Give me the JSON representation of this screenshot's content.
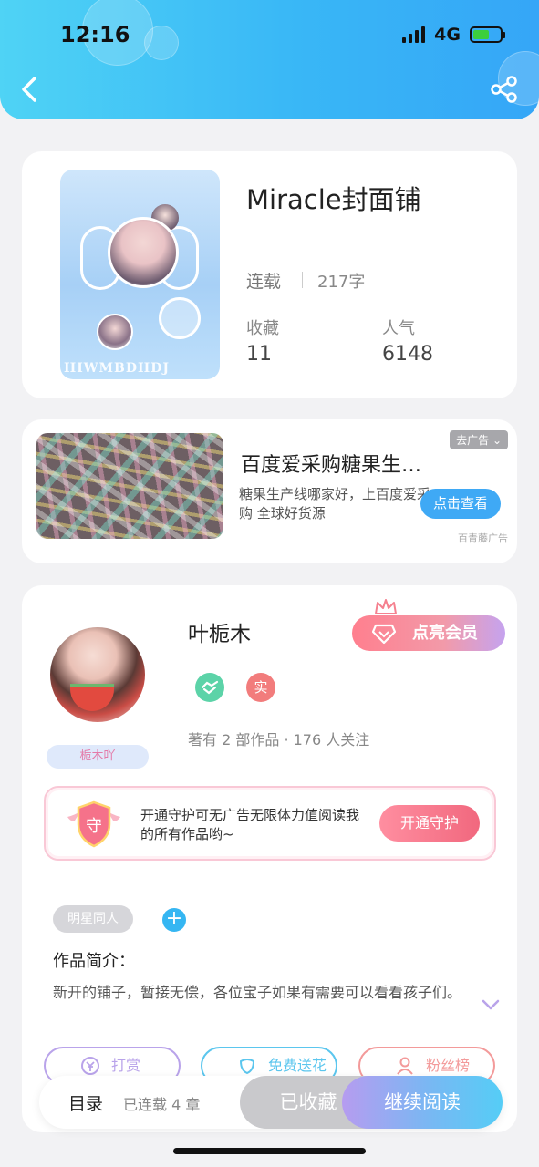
{
  "status_bar": {
    "time": "12:16",
    "network": "4G"
  },
  "book": {
    "title": "Miracle封面铺",
    "cover_watermark": "HIWMBDHDJ",
    "status": "连载",
    "word_count": "217字",
    "stats": [
      {
        "label": "收藏",
        "value": "11"
      },
      {
        "label": "人气",
        "value": "6148"
      }
    ]
  },
  "ad": {
    "title": "百度爱采购糖果生…",
    "description": "糖果生产线哪家好，上百度爱采购 全球好货源",
    "tag": "去广告 ⌄",
    "button": "点击查看",
    "source": "百青藤广告"
  },
  "author": {
    "name": "叶栀木",
    "nickname_tag": "栀木吖",
    "vip_button": "点亮会员",
    "real_badge": "实",
    "meta": "著有 2 部作品 · 176 人关注",
    "guard_text": "开通守护可无广告无限体力值阅读我的所有作品哟~",
    "guard_icon_char": "守",
    "guard_button": "开通守护",
    "genre_tag": "明星同人",
    "add_tag": "+",
    "intro_label": "作品简介：",
    "intro_text": "新开的铺子，暂接无偿，各位宝子如果有需要可以看看孩子们。",
    "actions": [
      {
        "label": "打赏",
        "color": "#b9a3ea"
      },
      {
        "label": "免费送花",
        "color": "#5bc6ee"
      },
      {
        "label": "粉丝榜",
        "color": "#f39a9a"
      }
    ]
  },
  "bottom_bar": {
    "toc": "目录",
    "chapters": "已连载 4 章",
    "favorited": "已收藏",
    "continue_reading": "继续阅读"
  },
  "colors": {
    "header": "#39b7f6",
    "accent_blue": "#35b6f2",
    "vip_pink": "#ff7f8e"
  }
}
